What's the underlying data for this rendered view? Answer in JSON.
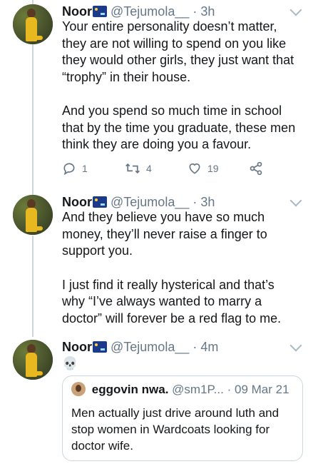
{
  "tweets": [
    {
      "name": "Noor",
      "handle": "@Tejumola__",
      "dot": "·",
      "time": "3h",
      "paragraphs": [
        "Your entire personality doesn’t matter, they are not willing to spend on you like they would other girls, they just want that “trophy” in their house.",
        "And you spend so much time in school that by the time you graduate, these men think they are doing you a favour."
      ],
      "reply_count": "1",
      "retweet_count": "4",
      "like_count": "19"
    },
    {
      "name": "Noor",
      "handle": "@Tejumola__",
      "dot": "·",
      "time": "3h",
      "paragraphs": [
        "And they believe you have so much money, they’ll never raise a finger to support you.",
        "I just find it really hysterical and that’s why “I’ve always wanted to marry a doctor” will forever be a red flag to me."
      ]
    },
    {
      "name": "Noor",
      "handle": "@Tejumola__",
      "dot": "·",
      "time": "4m",
      "emoji": "💀",
      "quote": {
        "name": "eggovin nwa.",
        "handle": "@sm1P...",
        "dot": "·",
        "date": "09 Mar 21",
        "text": "Men actually just drive around luth and stop women in Wardcoats looking for doctor wife."
      }
    }
  ],
  "colors": {
    "text": "#14171a",
    "secondary": "#657786",
    "border": "#ccd6dd",
    "flag": "#1b3a8a"
  },
  "icons": [
    "reply-icon",
    "retweet-icon",
    "like-icon",
    "share-icon",
    "chevron-down-icon",
    "flag-icon",
    "skull-emoji"
  ]
}
